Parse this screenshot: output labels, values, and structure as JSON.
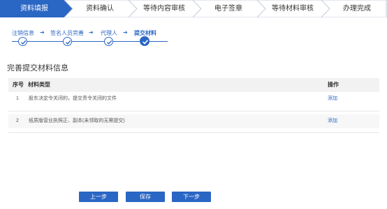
{
  "progress": {
    "steps": [
      {
        "label": "资料填报",
        "active": true
      },
      {
        "label": "资料确认",
        "active": false
      },
      {
        "label": "等待内容审核",
        "active": false
      },
      {
        "label": "电子签章",
        "active": false
      },
      {
        "label": "等待材料审核",
        "active": false
      },
      {
        "label": "办理完成",
        "active": false
      }
    ],
    "active_color": "#2a66c4",
    "inactive_color": "#ffffff"
  },
  "substeps": {
    "items": [
      {
        "label": "注销信息"
      },
      {
        "label": "签名人员完善"
      },
      {
        "label": "代理人"
      },
      {
        "label": "提交材料"
      }
    ],
    "arrow": "➔",
    "check_icon": "check-icon"
  },
  "section": {
    "title": "完善提交材料信息"
  },
  "table": {
    "headers": {
      "index": "序号",
      "type": "材料类型",
      "action": "操作"
    },
    "rows": [
      {
        "index": "1",
        "type": "股东决定令关闭的，提交责令关闭的文件",
        "action": "添加"
      },
      {
        "index": "2",
        "type": "纸质版营业执照正、副本(未领取的无需提交)",
        "action": "添加"
      }
    ]
  },
  "buttons": {
    "prev": "上一步",
    "save": "保存",
    "next": "下一步"
  },
  "colors": {
    "primary": "#2a66c4",
    "header_bg": "#f2f2f2"
  }
}
